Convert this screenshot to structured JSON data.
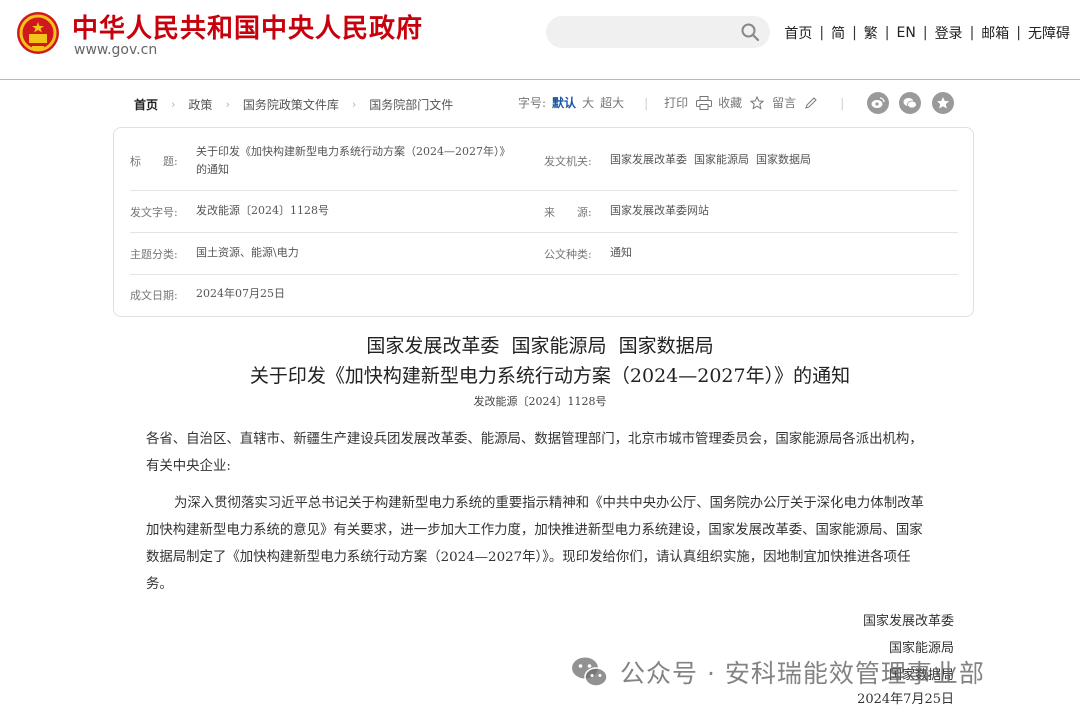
{
  "header": {
    "site_title": "中华人民共和国中央人民政府",
    "site_url": "www.gov.cn",
    "search": {
      "placeholder": ""
    },
    "nav": [
      "首页",
      "简",
      "繁",
      "EN",
      "登录",
      "邮箱",
      "无障碍"
    ]
  },
  "breadcrumb": [
    "首页",
    "政策",
    "国务院政策文件库",
    "国务院部门文件"
  ],
  "tools": {
    "font_size_label": "字号:",
    "font_sizes": [
      "默认",
      "大",
      "超大"
    ],
    "print_label": "打印",
    "favorite_label": "收藏",
    "comment_label": "留言"
  },
  "info": {
    "title_label": "标　　题:",
    "title_value_line1": "关于印发《加快构建新型电力系统行动方案（2024—2027年）》",
    "title_value_line2": "的通知",
    "issuer_label": "发文机关:",
    "issuer_value": "国家发展改革委  国家能源局  国家数据局",
    "doc_no_label": "发文字号:",
    "doc_no_value": "发改能源〔2024〕1128号",
    "source_label": "来　　源:",
    "source_value": "国家发展改革委网站",
    "category_label": "主题分类:",
    "category_value": "国土资源、能源\\电力",
    "type_label": "公文种类:",
    "type_value": "通知",
    "date_label": "成文日期:",
    "date_value": "2024年07月25日"
  },
  "document": {
    "title_line1": "国家发展改革委  国家能源局  国家数据局",
    "title_line2": "关于印发《加快构建新型电力系统行动方案（2024—2027年）》的通知",
    "number": "发改能源〔2024〕1128号",
    "addressee_line1": "各省、自治区、直辖市、新疆生产建设兵团发展改革委、能源局、数据管理部门，北京市城市管理委员会，国家能源局各派出机构，",
    "addressee_line2": "有关中央企业:",
    "para_line1": "为深入贯彻落实习近平总书记关于构建新型电力系统的重要指示精神和《中共中央办公厅、国务院办公厅关于深化电力体制改革",
    "para_line2": "加快构建新型电力系统的意见》有关要求，进一步加大工作力度，加快推进新型电力系统建设，国家发展改革委、国家能源局、国家",
    "para_line3": "数据局制定了《加快构建新型电力系统行动方案（2024—2027年）》。现印发给你们，请认真组织实施，因地制宜加快推进各项任",
    "para_line4": "务。",
    "sign1": "国家发展改革委",
    "sign2": "国家能源局",
    "sign3": "国家数据局",
    "sign_date": "2024年7月25日"
  },
  "watermark": {
    "text": "公众号 · 安科瑞能效管理事业部"
  },
  "colors": {
    "brand_red": "#c7000b",
    "accent_blue": "#1a56a6"
  }
}
